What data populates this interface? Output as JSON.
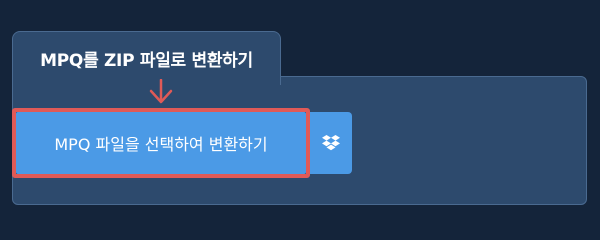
{
  "tab": {
    "title": "MPQ를 ZIP 파일로 변환하기"
  },
  "converter": {
    "button_label": "MPQ 파일을 선택하여 변환하기",
    "dropbox_icon": "dropbox-icon"
  },
  "colors": {
    "background": "#14243a",
    "panel": "#2d4a6d",
    "button": "#4b9ae6",
    "highlight": "#e05a57"
  }
}
